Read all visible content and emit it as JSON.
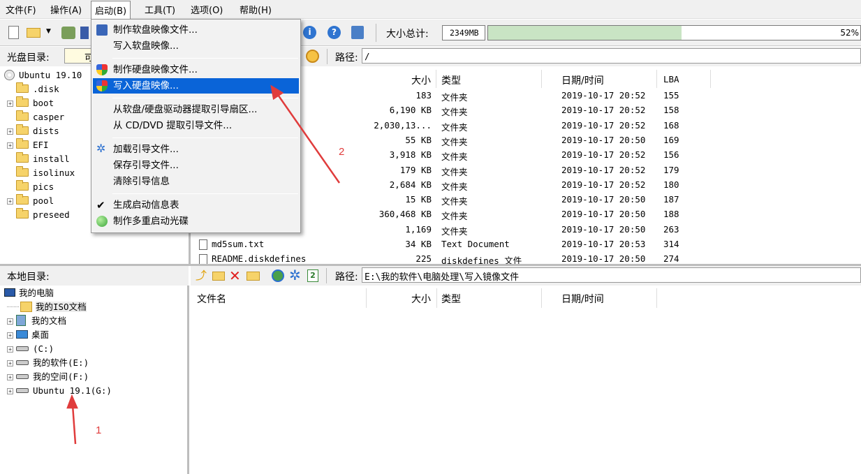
{
  "menubar": {
    "items": [
      "文件(F)",
      "操作(A)",
      "启动(B)",
      "工具(T)",
      "选项(O)",
      "帮助(H)"
    ]
  },
  "toolbar": {
    "size_label": "大小总计:",
    "size_value": "2349MB",
    "percent": "52%",
    "percent_fill": 0.52
  },
  "cd_dir": {
    "label": "光盘目录:",
    "field_value": "可",
    "path_label": "路径:",
    "path_value": "/"
  },
  "cd_tree": [
    {
      "label": "Ubuntu 19.10",
      "level": 0,
      "expand": false,
      "disc": true
    },
    {
      "label": ".disk",
      "level": 1,
      "expand": false
    },
    {
      "label": "boot",
      "level": 1,
      "expand": true
    },
    {
      "label": "casper",
      "level": 1,
      "expand": false
    },
    {
      "label": "dists",
      "level": 1,
      "expand": true
    },
    {
      "label": "EFI",
      "level": 1,
      "expand": true
    },
    {
      "label": "install",
      "level": 1,
      "expand": false
    },
    {
      "label": "isolinux",
      "level": 1,
      "expand": false
    },
    {
      "label": "pics",
      "level": 1,
      "expand": false
    },
    {
      "label": "pool",
      "level": 1,
      "expand": true
    },
    {
      "label": "preseed",
      "level": 1,
      "expand": false
    }
  ],
  "cd_list": {
    "headers": {
      "size": "大小",
      "type": "类型",
      "date": "日期/时间",
      "lba": "LBA"
    },
    "rows": [
      {
        "name": "",
        "size": "183",
        "type": "文件夹",
        "date": "2019-10-17 20:52",
        "lba": "155"
      },
      {
        "name": "",
        "size": "6,190 KB",
        "type": "文件夹",
        "date": "2019-10-17 20:52",
        "lba": "158"
      },
      {
        "name": "",
        "size": "2,030,13...",
        "type": "文件夹",
        "date": "2019-10-17 20:52",
        "lba": "168"
      },
      {
        "name": "",
        "size": "55 KB",
        "type": "文件夹",
        "date": "2019-10-17 20:50",
        "lba": "169"
      },
      {
        "name": "",
        "size": "3,918 KB",
        "type": "文件夹",
        "date": "2019-10-17 20:52",
        "lba": "156"
      },
      {
        "name": "",
        "size": "179 KB",
        "type": "文件夹",
        "date": "2019-10-17 20:52",
        "lba": "179"
      },
      {
        "name": "",
        "size": "2,684 KB",
        "type": "文件夹",
        "date": "2019-10-17 20:52",
        "lba": "180"
      },
      {
        "name": "",
        "size": "15 KB",
        "type": "文件夹",
        "date": "2019-10-17 20:50",
        "lba": "187"
      },
      {
        "name": "",
        "size": "360,468 KB",
        "type": "文件夹",
        "date": "2019-10-17 20:50",
        "lba": "188"
      },
      {
        "name": "",
        "size": "1,169",
        "type": "文件夹",
        "date": "2019-10-17 20:50",
        "lba": "263"
      },
      {
        "name": "md5sum.txt",
        "size": "34 KB",
        "type": "Text Document",
        "date": "2019-10-17 20:53",
        "lba": "314"
      },
      {
        "name": "README.diskdefines",
        "size": "225",
        "type": "diskdefines 文件",
        "date": "2019-10-17 20:50",
        "lba": "274"
      }
    ]
  },
  "local_dir": {
    "label": "本地目录:",
    "path_label": "路径:",
    "path_value": "E:\\我的软件\\电脑处理\\写入镜像文件"
  },
  "local_tree": [
    {
      "label": "我的电脑",
      "level": 0,
      "expand": false,
      "icon": "computer"
    },
    {
      "label": "我的ISO文档",
      "level": 1,
      "expand": false,
      "icon": "folder"
    },
    {
      "label": "我的文档",
      "level": 1,
      "expand": true,
      "icon": "docs"
    },
    {
      "label": "桌面",
      "level": 1,
      "expand": true,
      "icon": "desktop"
    },
    {
      "label": "(C:)",
      "level": 1,
      "expand": true,
      "icon": "drive"
    },
    {
      "label": "我的软件(E:)",
      "level": 1,
      "expand": true,
      "icon": "drive"
    },
    {
      "label": "我的空间(F:)",
      "level": 1,
      "expand": true,
      "icon": "drive"
    },
    {
      "label": "Ubuntu 19.1(G:)",
      "level": 1,
      "expand": true,
      "icon": "drive"
    }
  ],
  "local_list": {
    "headers": {
      "name": "文件名",
      "size": "大小",
      "type": "类型",
      "date": "日期/时间"
    }
  },
  "boot_menu": [
    {
      "label": "制作软盘映像文件...",
      "icon": "floppy-icon",
      "sel": false
    },
    {
      "label": "写入软盘映像...",
      "icon": "",
      "sel": false
    },
    {
      "sep": true
    },
    {
      "label": "制作硬盘映像文件...",
      "icon": "shield-icon",
      "sel": false
    },
    {
      "label": "写入硬盘映像...",
      "icon": "shield-icon",
      "sel": true
    },
    {
      "sep": true
    },
    {
      "label": "从软盘/硬盘驱动器提取引导扇区...",
      "icon": "",
      "sel": false
    },
    {
      "label": "从 CD/DVD 提取引导文件...",
      "icon": "",
      "sel": false
    },
    {
      "sep": true
    },
    {
      "label": "加载引导文件...",
      "icon": "gear-icon",
      "sel": false
    },
    {
      "label": "保存引导文件...",
      "icon": "",
      "sel": false
    },
    {
      "label": "清除引导信息",
      "icon": "",
      "sel": false
    },
    {
      "sep": true
    },
    {
      "label": "生成启动信息表",
      "icon": "check-icon",
      "sel": false
    },
    {
      "label": "制作多重启动光碟",
      "icon": "globe-icon",
      "sel": false
    }
  ],
  "annotations": {
    "one": "1",
    "two": "2"
  },
  "colors": {
    "selection": "#0a64d8",
    "arrow": "#e03c3c",
    "progress": "#c9e4c4"
  }
}
